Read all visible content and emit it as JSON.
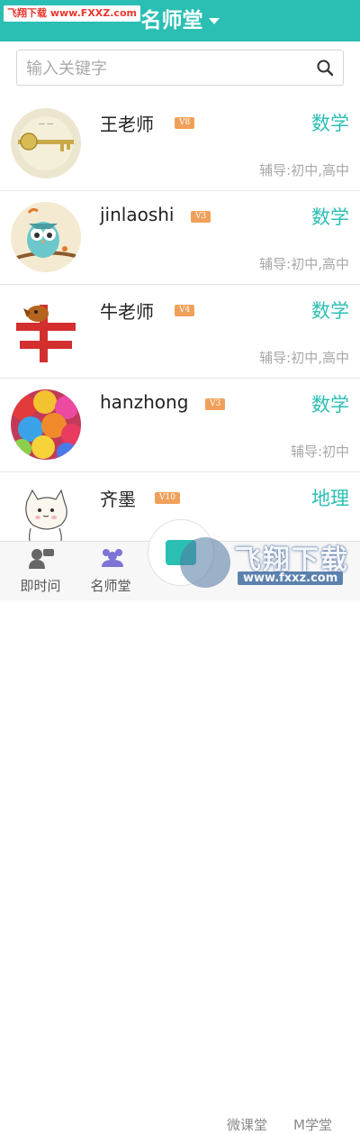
{
  "watermark_top": {
    "part1": "飞翔下载",
    "part2": "www.FXXZ.com"
  },
  "header": {
    "title": "名师堂"
  },
  "search": {
    "placeholder": "输入关键字"
  },
  "teachers": [
    {
      "name": "王老师",
      "level": "V8",
      "subject": "数学",
      "tutor": "辅导:初中,高中"
    },
    {
      "name": "jinlaoshi",
      "level": "V3",
      "subject": "数学",
      "tutor": "辅导:初中,高中"
    },
    {
      "name": "牛老师",
      "level": "V4",
      "subject": "数学",
      "tutor": "辅导:初中,高中"
    },
    {
      "name": "hanzhong",
      "level": "V3",
      "subject": "数学",
      "tutor": "辅导:初中"
    },
    {
      "name": "齐墨",
      "level": "V10",
      "subject": "地理",
      "tutor": ""
    }
  ],
  "bottom_nav": {
    "tabs": [
      {
        "label": "即时问"
      },
      {
        "label": "名师堂"
      },
      {
        "label": "微课堂"
      },
      {
        "label": "M学堂"
      }
    ]
  },
  "watermark_br": {
    "big": "飞翔下载",
    "small": "www.fxxz.com"
  },
  "colors": {
    "accent": "#2bbfb4",
    "badge": "#f0a05a"
  }
}
